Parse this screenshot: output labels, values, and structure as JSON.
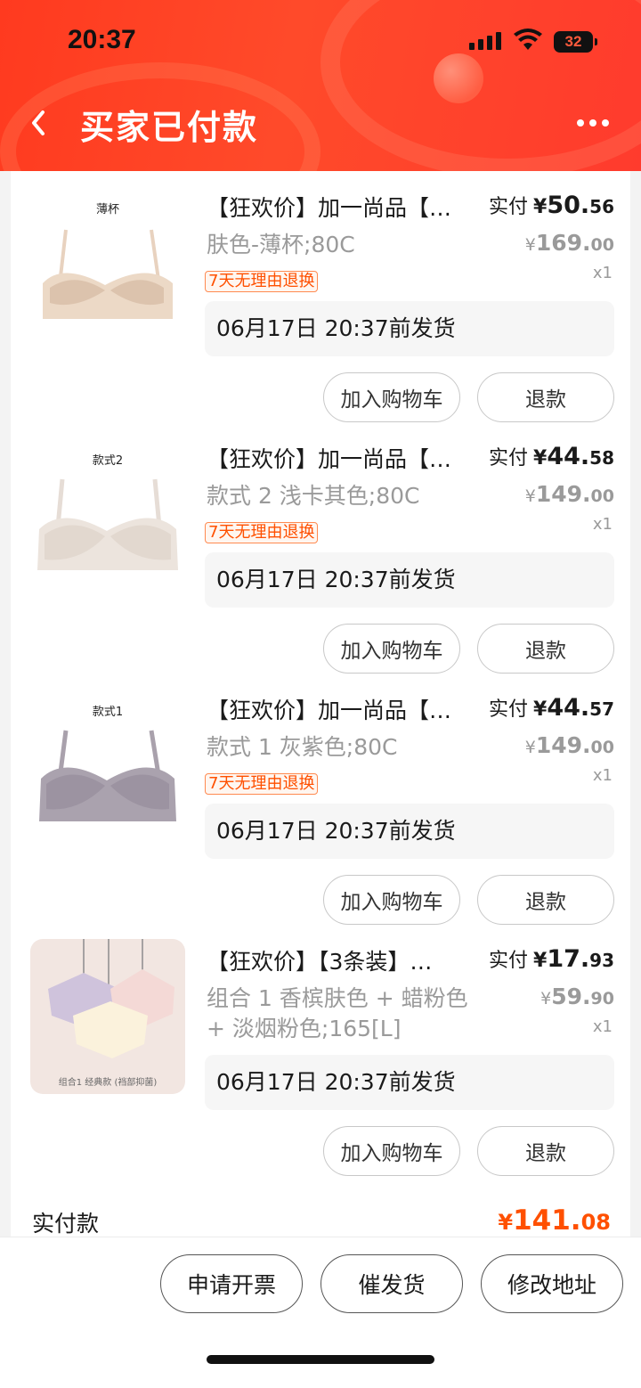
{
  "status_bar": {
    "time": "20:37",
    "battery": "32"
  },
  "header": {
    "title": "买家已付款"
  },
  "items": [
    {
      "thumb_label": "薄杯",
      "title": "【狂欢价】加一尚品【…",
      "paid_label": "实付",
      "paid_yen": "¥",
      "paid_int": "50.",
      "paid_dec": "56",
      "sku": "肤色-薄杯;80C",
      "orig_yen": "¥",
      "orig_int": "169.",
      "orig_dec": "00",
      "qty": "x1",
      "tag": "7天无理由退换",
      "ship": "06月17日 20:37前发货",
      "btn_cart": "加入购物车",
      "btn_refund": "退款"
    },
    {
      "thumb_label": "款式2",
      "title": "【狂欢价】加一尚品【…",
      "paid_label": "实付",
      "paid_yen": "¥",
      "paid_int": "44.",
      "paid_dec": "58",
      "sku": "款式 2 浅卡其色;80C",
      "orig_yen": "¥",
      "orig_int": "149.",
      "orig_dec": "00",
      "qty": "x1",
      "tag": "7天无理由退换",
      "ship": "06月17日 20:37前发货",
      "btn_cart": "加入购物车",
      "btn_refund": "退款"
    },
    {
      "thumb_label": "款式1",
      "title": "【狂欢价】加一尚品【…",
      "paid_label": "实付",
      "paid_yen": "¥",
      "paid_int": "44.",
      "paid_dec": "57",
      "sku": "款式 1 灰紫色;80C",
      "orig_yen": "¥",
      "orig_int": "149.",
      "orig_dec": "00",
      "qty": "x1",
      "tag": "7天无理由退换",
      "ship": "06月17日 20:37前发货",
      "btn_cart": "加入购物车",
      "btn_refund": "退款"
    },
    {
      "thumb_label": "组合1 经典款 (裆部抑菌)",
      "title": "【狂欢价】【3条装】…",
      "paid_label": "实付",
      "paid_yen": "¥",
      "paid_int": "17.",
      "paid_dec": "93",
      "sku": "组合 1 香槟肤色 + 蜡粉色 + 淡烟粉色;165[L]",
      "orig_yen": "¥",
      "orig_int": "59.",
      "orig_dec": "90",
      "qty": "x1",
      "ship": "06月17日 20:37前发货",
      "btn_cart": "加入购物车",
      "btn_refund": "退款"
    }
  ],
  "summary": {
    "label": "实付款",
    "yen": "¥",
    "int": "141.",
    "dec": "08"
  },
  "bottom_actions": {
    "invoice": "申请开票",
    "urge": "催发货",
    "address": "修改地址"
  },
  "colors": {
    "brand": "#ff4a2a",
    "accent": "#ff5000"
  }
}
